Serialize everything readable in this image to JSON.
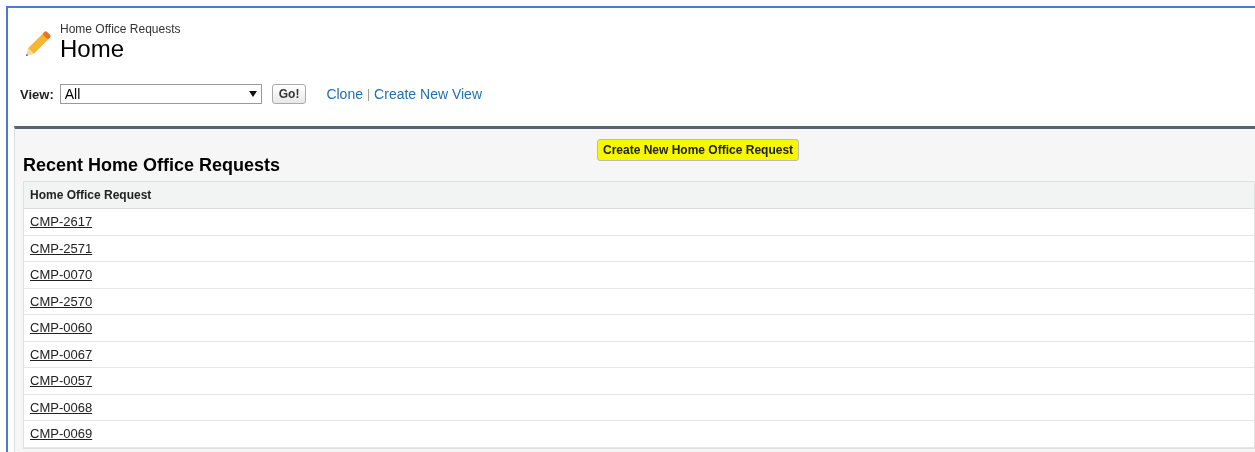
{
  "header": {
    "breadcrumb": "Home Office Requests",
    "title": "Home"
  },
  "view_bar": {
    "label": "View:",
    "select": {
      "value": "All"
    },
    "go_button": "Go!",
    "links": [
      "Clone",
      "Create New View"
    ],
    "separator": "|"
  },
  "panel": {
    "title": "Recent Home Office Requests",
    "new_button": "Create New Home Office Request",
    "table": {
      "columns": [
        "Home Office Request"
      ],
      "rows": [
        [
          "CMP-2617"
        ],
        [
          "CMP-2571"
        ],
        [
          "CMP-0070"
        ],
        [
          "CMP-2570"
        ],
        [
          "CMP-0060"
        ],
        [
          "CMP-0067"
        ],
        [
          "CMP-0057"
        ],
        [
          "CMP-0068"
        ],
        [
          "CMP-0069"
        ]
      ]
    }
  }
}
